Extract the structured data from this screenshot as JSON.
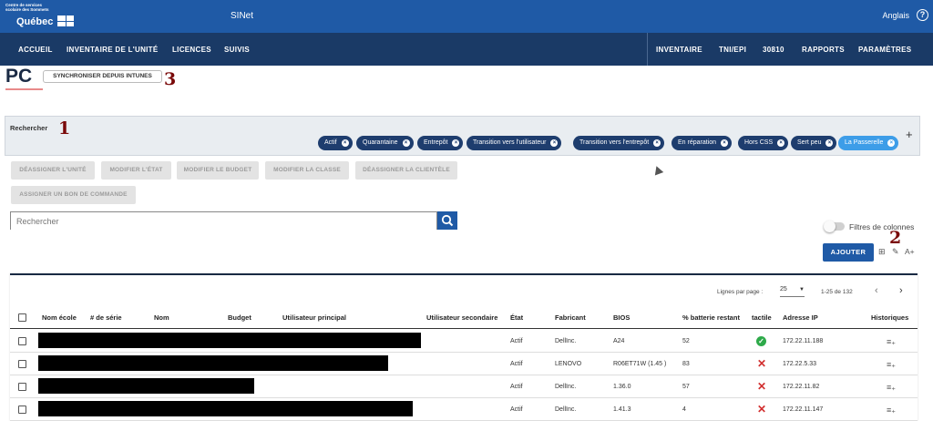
{
  "header": {
    "logo_small": "Centre de services scolaire des Sommets",
    "logo_big": "Québec",
    "app_name": "SINet",
    "language": "Anglais",
    "help": "?"
  },
  "nav": {
    "left": [
      "ACCUEIL",
      "INVENTAIRE DE L'UNITÉ",
      "LICENCES",
      "SUIVIS"
    ],
    "right": [
      "INVENTAIRE",
      "TNI/EPI",
      "30810",
      "RAPPORTS",
      "PARAMÈTRES"
    ]
  },
  "page": {
    "title": "PC",
    "sync_button": "SYNCHRONISER DEPUIS INTUNES",
    "markers": [
      "1",
      "2",
      "3"
    ]
  },
  "search_panel": {
    "label": "Rechercher",
    "chips": [
      {
        "label": "Actif",
        "active": false
      },
      {
        "label": "Quarantaine",
        "active": false
      },
      {
        "label": "Entrepôt",
        "active": false
      },
      {
        "label": "Transition vers l'utilisateur",
        "active": false
      },
      {
        "label": "Transition vers l'entrepôt",
        "active": false
      },
      {
        "label": "En réparation",
        "active": false
      },
      {
        "label": "Hors CSS",
        "active": false
      },
      {
        "label": "Sert peu",
        "active": false
      },
      {
        "label": "La Passerelle",
        "active": true
      }
    ],
    "add": "+"
  },
  "actions": [
    "DÉASSIGNER L'UNITÉ",
    "MODIFIER L'ÉTAT",
    "MODIFIER LE BUDGET",
    "MODIFIER LA CLASSE",
    "DÉASSIGNER LA CLIENTÈLE",
    "ASSIGNER UN BON DE COMMANDE"
  ],
  "search": {
    "placeholder": "Rechercher"
  },
  "column_filters": {
    "label": "Filtres de colonnes",
    "enabled": false
  },
  "toolbar": {
    "add_button": "AJOUTER",
    "font_icon": "A+"
  },
  "pagination": {
    "rows_per_page_label": "Lignes par page :",
    "rows_per_page": "25",
    "range": "1-25 de 132"
  },
  "table": {
    "headers": [
      "Nom école",
      "# de série",
      "Nom",
      "Budget",
      "Utilisateur principal",
      "Utilisateur secondaire",
      "État",
      "Fabricant",
      "BIOS",
      "% batterie restant",
      "tactile",
      "Adresse IP",
      "Historiques"
    ],
    "rows": [
      {
        "etat": "Actif",
        "fabricant": "DellInc.",
        "bios": "A24",
        "batterie": "52",
        "tactile": true,
        "ip": "172.22.11.188"
      },
      {
        "etat": "Actif",
        "fabricant": "LENOVO",
        "bios": "R06ET71W (1.45 )",
        "batterie": "83",
        "tactile": false,
        "ip": "172.22.5.33"
      },
      {
        "etat": "Actif",
        "fabricant": "DellInc.",
        "bios": "1.36.0",
        "batterie": "57",
        "tactile": false,
        "ip": "172.22.11.82"
      },
      {
        "etat": "Actif",
        "fabricant": "DellInc.",
        "bios": "1.41.3",
        "batterie": "4",
        "tactile": false,
        "ip": "172.22.11.147"
      }
    ]
  },
  "colors": {
    "topbar": "#1f5aa6",
    "navbar": "#1a3a66",
    "chip": "#1e3d6e",
    "chip_active": "#3d9de8",
    "marker": "#7a0a0a"
  }
}
